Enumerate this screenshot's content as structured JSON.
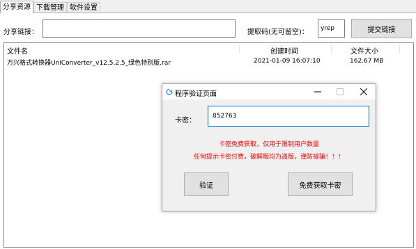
{
  "tabs": [
    "分享资源",
    "下载管理",
    "软件设置"
  ],
  "share": {
    "link_label": "分享链接：",
    "link_value": "",
    "code_label": "提取码(无可留空)：",
    "code_value": "yrep",
    "submit_label": "提交链接"
  },
  "file_list": {
    "columns": [
      "文件名",
      "创建时间",
      "文件大小"
    ],
    "rows": [
      {
        "name": "万兴格式转换器UniConverter_v12.5.2.5_绿色特别版.rar",
        "created": "2021-01-09 16:07:10",
        "size": "162.67 MB"
      }
    ]
  },
  "dialog": {
    "title": "程序验证页面",
    "key_label": "卡密：",
    "key_value": "852763",
    "note_line1": "卡密免费获取，仅用于限制用户数量",
    "note_line2": "任何提示卡密付费，破解版均为盗版，谨防被骗！！！",
    "verify_label": "验证",
    "free_key_label": "免费获取卡密",
    "note_color": "#ff0000",
    "accent_color": "#0078d7"
  }
}
